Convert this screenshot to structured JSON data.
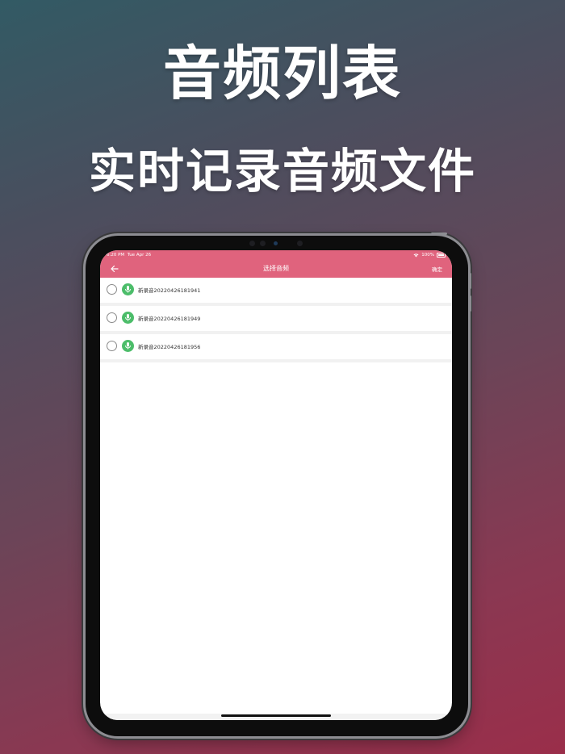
{
  "promo": {
    "headline": "音频列表",
    "subheadline": "实时记录音频文件"
  },
  "status_bar": {
    "time": "6:20 PM",
    "date": "Tue Apr 26",
    "battery": "100%"
  },
  "nav": {
    "back_icon": "arrow-left-icon",
    "title": "选择音频",
    "confirm_label": "确定"
  },
  "audio_list": {
    "items": [
      {
        "label": "新录音20220426181941",
        "selected": false,
        "icon": "microphone-icon"
      },
      {
        "label": "新录音20220426181949",
        "selected": false,
        "icon": "microphone-icon"
      },
      {
        "label": "新录音20220426181956",
        "selected": false,
        "icon": "microphone-icon"
      }
    ]
  },
  "colors": {
    "nav_bar": "#e0637d",
    "mic_badge": "#4cbd6a",
    "background_start": "#325a64",
    "background_end": "#9a2e4a"
  }
}
